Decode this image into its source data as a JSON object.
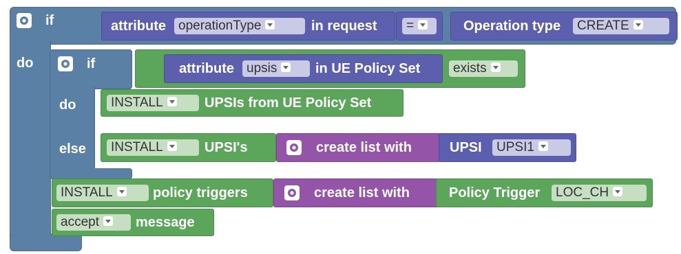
{
  "blocks": {
    "outer_if": {
      "if_label": "if",
      "do_label": "do"
    },
    "outer_cond": {
      "attr_label": "attribute",
      "attr_value": "operationType",
      "attr_suffix": "in request",
      "op_value": "=",
      "rhs_label": "Operation type",
      "rhs_value": "CREATE"
    },
    "inner_if": {
      "if_label": "if",
      "do_label": "do",
      "else_label": "else",
      "cond_attr_label": "attribute",
      "cond_attr_value": "upsis",
      "cond_attr_suffix": "in UE Policy Set",
      "cond_check_value": "exists"
    },
    "do_install": {
      "action_value": "INSTALL",
      "text": "UPSIs from UE Policy Set"
    },
    "else_install": {
      "action_value": "INSTALL",
      "text": "UPSI's",
      "list_label": "create list with",
      "item_label": "UPSI",
      "item_value": "UPSI1"
    },
    "install_triggers": {
      "action_value": "INSTALL",
      "text": "policy triggers",
      "list_label": "create list with",
      "item_label": "Policy Trigger",
      "item_value": "LOC_CH"
    },
    "accept_msg": {
      "action_value": "accept",
      "text": "message"
    }
  }
}
